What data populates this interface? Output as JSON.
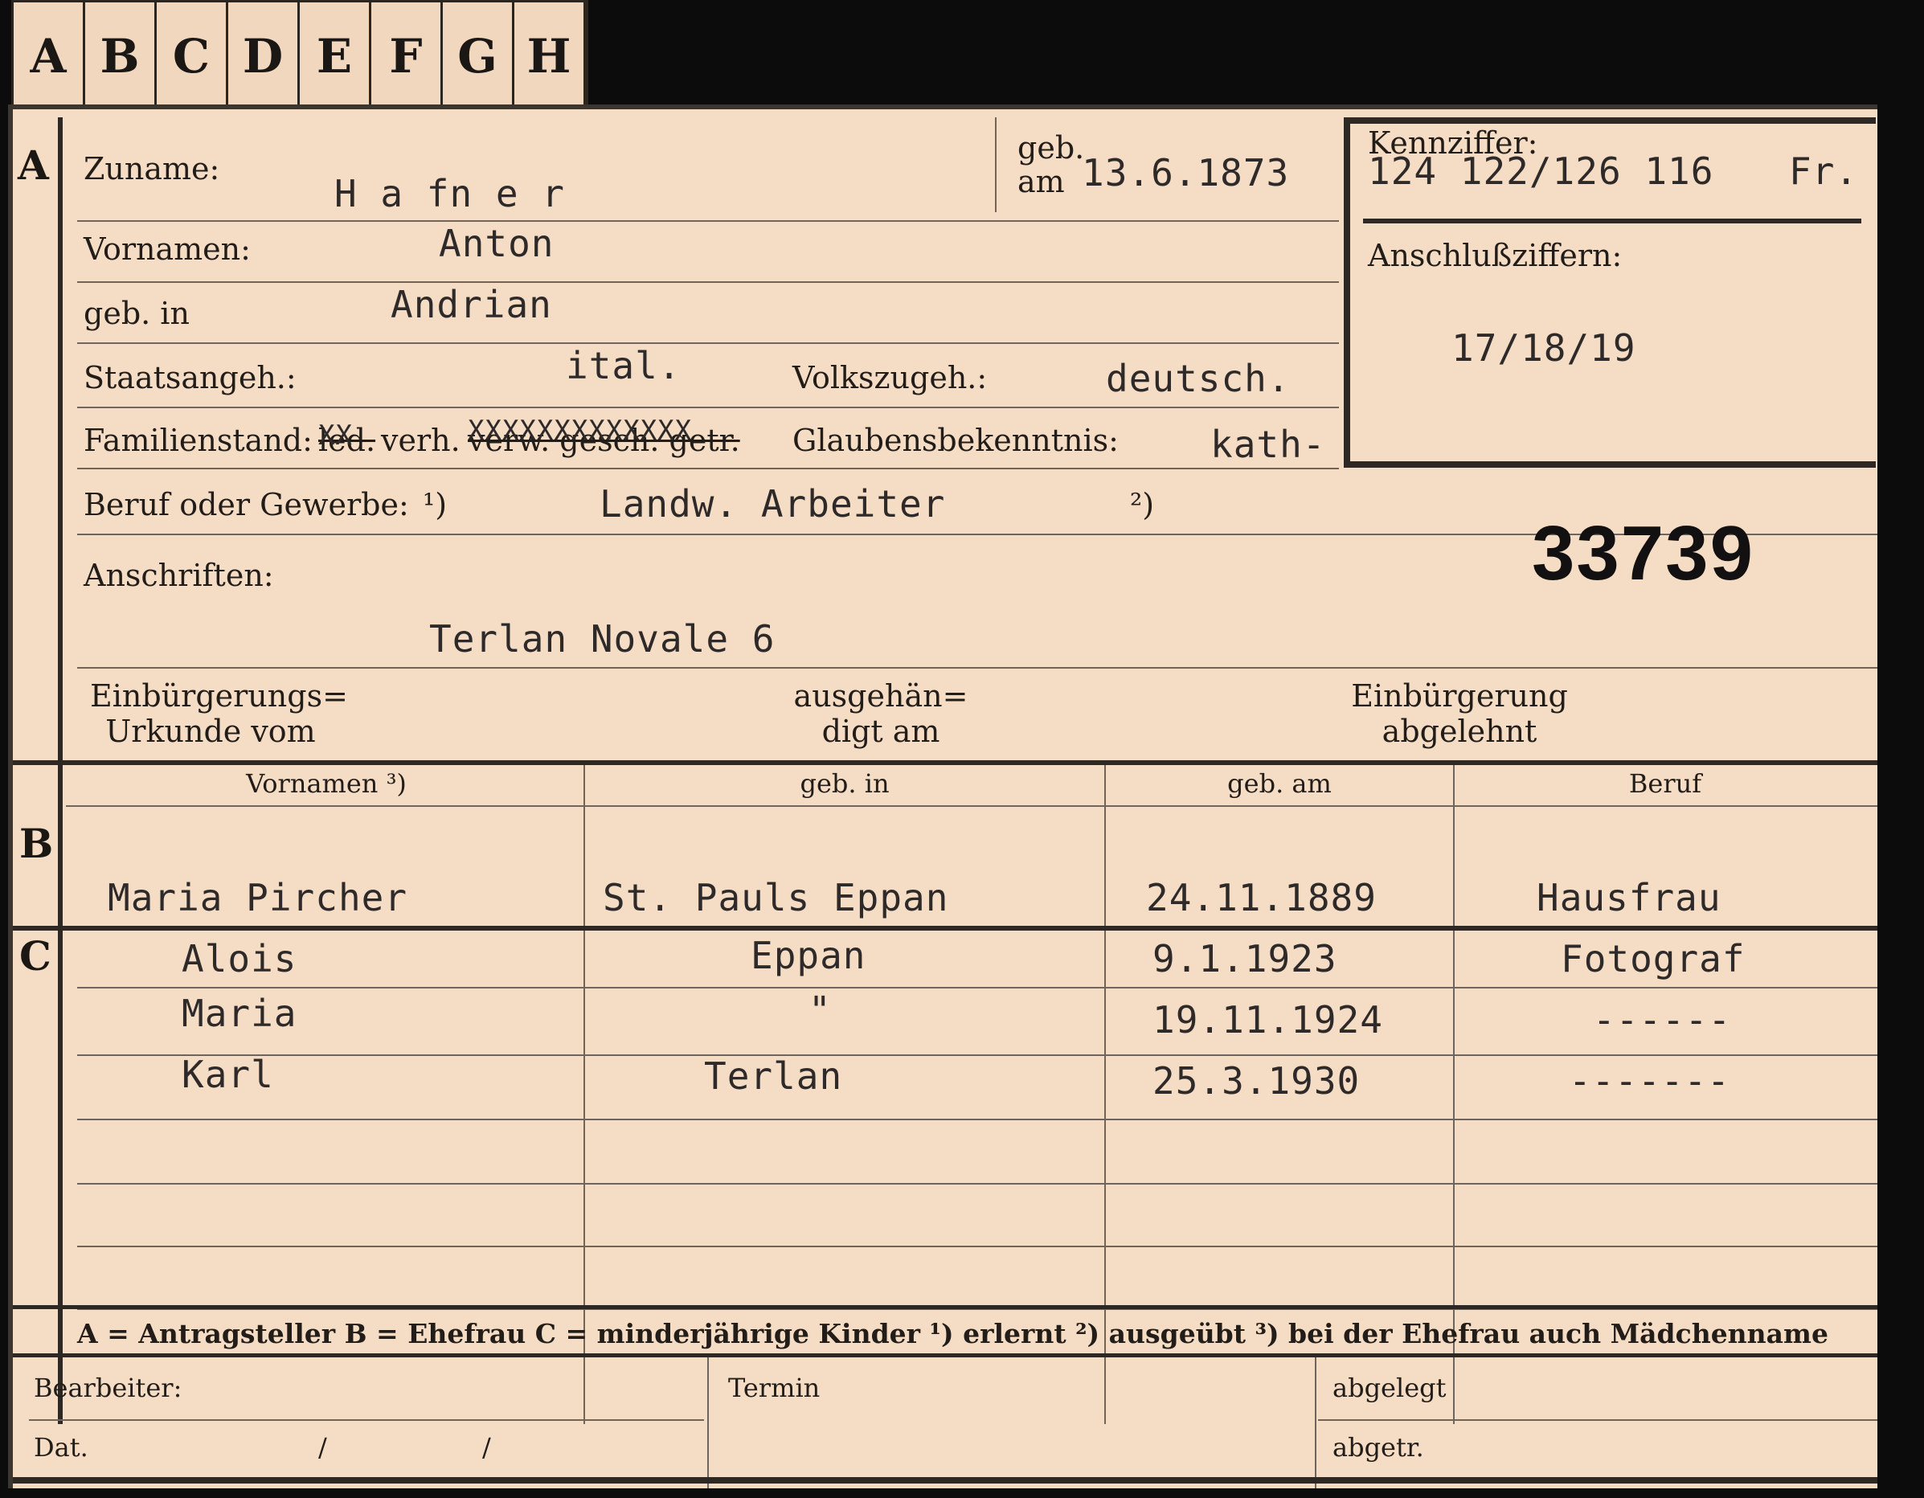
{
  "tabs": [
    "A",
    "B",
    "C",
    "D",
    "E",
    "F",
    "G",
    "H"
  ],
  "section_a": {
    "letter": "A",
    "zuname_label": "Zuname:",
    "zuname_value": "H a fn e r",
    "geb_am_label_1": "geb.",
    "geb_am_label_2": "am",
    "geb_am_value": "13.6.1873",
    "kennziffer_label": "Kennziffer:",
    "kennziffer_value": "124 122/126 116",
    "kennziffer_suffix": "Fr.",
    "anschluss_label": "Anschlußziffern:",
    "anschluss_value": "17/18/19",
    "vornamen_label": "Vornamen:",
    "vornamen_value": "Anton",
    "geb_in_label": "geb. in",
    "geb_in_value": "Andrian",
    "staatsangeh_label": "Staatsangeh.:",
    "staatsangeh_value": "ital.",
    "volkszugeh_label": "Volkszugeh.:",
    "volkszugeh_value": "deutsch.",
    "familienstand_label": "Familienstand:",
    "familienstand_struck_1": "led.",
    "familienstand_value": "verh.",
    "familienstand_struck_2": "verw. gesch. getr.",
    "familienstand_x_1": "XX",
    "familienstand_x_2": "XXXXXXXXXXXXX",
    "glaubens_label": "Glaubensbekenntnis:",
    "glaubens_value": "kath-",
    "beruf_label": "Beruf oder Gewerbe:",
    "beruf_note1": "¹)",
    "beruf_value": "Landw. Arbeiter",
    "beruf_note2": "²)",
    "file_number": "33739",
    "anschriften_label": "Anschriften:",
    "anschriften_value": "Terlan Novale 6",
    "einbuergerung_label_1": "Einbürgerungs=",
    "einbuergerung_label_2": "Urkunde vom",
    "ausgehaen_label_1": "ausgehän=",
    "ausgehaen_label_2": "digt am",
    "abgelehnt_label_1": "Einbürgerung",
    "abgelehnt_label_2": "abgelehnt"
  },
  "section_b": {
    "letter": "B",
    "headers": [
      "Vornamen ³)",
      "geb. in",
      "geb. am",
      "Beruf"
    ],
    "row": {
      "vornamen": "Maria    Pircher",
      "geb_in": "St. Pauls Eppan",
      "geb_am": "24.11.1889",
      "beruf": "Hausfrau"
    }
  },
  "section_c": {
    "letter": "C",
    "rows": [
      {
        "vornamen": "Alois",
        "geb_in": "Eppan",
        "geb_am": "9.1.1923",
        "beruf": "Fotograf"
      },
      {
        "vornamen": "Maria",
        "geb_in": "\"",
        "geb_am": "19.11.1924",
        "beruf": "------"
      },
      {
        "vornamen": "Karl",
        "geb_in": "Terlan",
        "geb_am": "25.3.1930",
        "beruf": "-------"
      }
    ]
  },
  "legend": "A = Antragsteller   B = Ehefrau   C = minderjährige Kinder   ¹) erlernt   ²) ausgeübt   ³) bei der Ehefrau auch Mädchenname",
  "footer": {
    "bearbeiter_label": "Bearbeiter:",
    "termin_label": "Termin",
    "abgelegt_label": "abgelegt",
    "dat_label": "Dat.",
    "dat_sep_1": "/",
    "dat_sep_2": "/",
    "abgetr_label": "abgetr."
  }
}
